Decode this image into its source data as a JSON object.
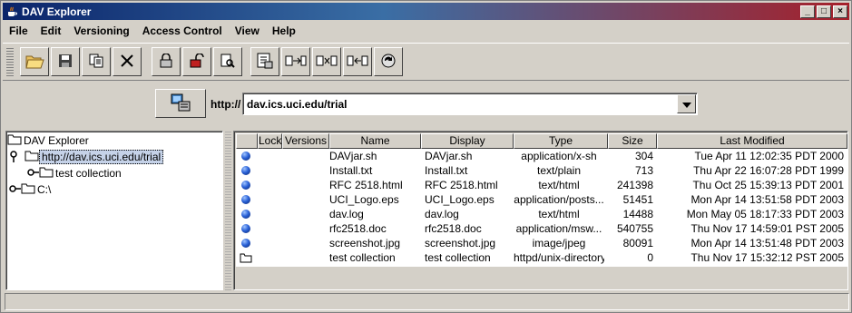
{
  "window": {
    "title": "DAV Explorer",
    "min_label": "_",
    "max_label": "□",
    "close_label": "×"
  },
  "menubar": {
    "items": [
      "File",
      "Edit",
      "Versioning",
      "Access Control",
      "View",
      "Help"
    ]
  },
  "toolbar": {
    "buttons": [
      {
        "name": "open-icon"
      },
      {
        "name": "save-icon"
      },
      {
        "name": "copy-icon"
      },
      {
        "name": "delete-icon"
      },
      {
        "name": "lock-icon"
      },
      {
        "name": "unlock-icon"
      },
      {
        "name": "view-properties-icon"
      },
      {
        "name": "view-lock-properties-icon"
      },
      {
        "name": "version-checkin-icon"
      },
      {
        "name": "version-checkout-icon"
      },
      {
        "name": "version-uncheckout-icon"
      },
      {
        "name": "refresh-icon"
      }
    ]
  },
  "address": {
    "prefix": "http://",
    "value": "dav.ics.uci.edu/trial"
  },
  "tree": {
    "root": "DAV Explorer",
    "selected_node": "http://dav.ics.uci.edu/trial",
    "child_collection": "test collection",
    "drive": "C:\\"
  },
  "table": {
    "columns": [
      "",
      "Lock",
      "Versions",
      "Name",
      "Display",
      "Type",
      "Size",
      "Last Modified"
    ],
    "rows": [
      {
        "icon": "file",
        "name": "DAVjar.sh",
        "display": "DAVjar.sh",
        "type": "application/x-sh",
        "size": "304",
        "modified": "Tue Apr 11 12:02:35 PDT 2000"
      },
      {
        "icon": "file",
        "name": "Install.txt",
        "display": "Install.txt",
        "type": "text/plain",
        "size": "713",
        "modified": "Thu Apr 22 16:07:28 PDT 1999"
      },
      {
        "icon": "file",
        "name": "RFC 2518.html",
        "display": "RFC 2518.html",
        "type": "text/html",
        "size": "241398",
        "modified": "Thu Oct 25 15:39:13 PDT 2001"
      },
      {
        "icon": "file",
        "name": "UCI_Logo.eps",
        "display": "UCI_Logo.eps",
        "type": "application/posts...",
        "size": "51451",
        "modified": "Mon Apr 14 13:51:58 PDT 2003"
      },
      {
        "icon": "file",
        "name": "dav.log",
        "display": "dav.log",
        "type": "text/html",
        "size": "14488",
        "modified": "Mon May 05 18:17:33 PDT 2003"
      },
      {
        "icon": "file",
        "name": "rfc2518.doc",
        "display": "rfc2518.doc",
        "type": "application/msw...",
        "size": "540755",
        "modified": "Thu Nov 17 14:59:01 PST 2005"
      },
      {
        "icon": "file",
        "name": "screenshot.jpg",
        "display": "screenshot.jpg",
        "type": "image/jpeg",
        "size": "80091",
        "modified": "Mon Apr 14 13:51:48 PDT 2003"
      },
      {
        "icon": "folder",
        "name": "test collection",
        "display": "test collection",
        "type": "httpd/unix-directory",
        "size": "0",
        "modified": "Thu Nov 17 15:32:12 PST 2005"
      }
    ]
  },
  "status": {
    "text": ""
  }
}
